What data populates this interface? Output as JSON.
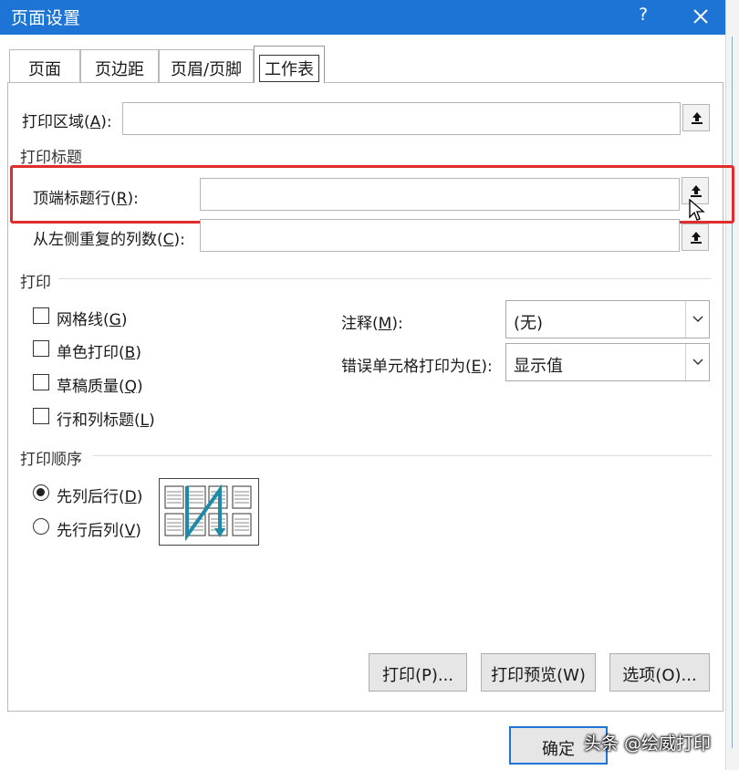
{
  "window": {
    "title": "页面设置",
    "help": "?"
  },
  "tabs": [
    "页面",
    "页边距",
    "页眉/页脚",
    "工作表"
  ],
  "print_area": {
    "label": "打印区域(",
    "hotkey": "A",
    "suffix": "):",
    "value": ""
  },
  "print_titles": {
    "section": "打印标题",
    "top_rows": {
      "label": "顶端标题行(",
      "hotkey": "R",
      "suffix": "):",
      "value": ""
    },
    "left_cols": {
      "label": "从左侧重复的列数(",
      "hotkey": "C",
      "suffix": "):",
      "value": ""
    }
  },
  "print": {
    "section": "打印",
    "checkboxes": [
      {
        "label": "网格线(",
        "hotkey": "G",
        "suffix": ")",
        "checked": false
      },
      {
        "label": "单色打印(",
        "hotkey": "B",
        "suffix": ")",
        "checked": false
      },
      {
        "label": "草稿质量(",
        "hotkey": "Q",
        "suffix": ")",
        "checked": false
      },
      {
        "label": "行和列标题(",
        "hotkey": "L",
        "suffix": ")",
        "checked": false
      }
    ],
    "comments": {
      "label": "注释(",
      "hotkey": "M",
      "suffix": "):",
      "value": "(无)"
    },
    "errors": {
      "label": "错误单元格打印为(",
      "hotkey": "E",
      "suffix": "):",
      "value": "显示值"
    }
  },
  "page_order": {
    "section": "打印顺序",
    "options": [
      {
        "label": "先列后行(",
        "hotkey": "D",
        "suffix": ")",
        "selected": true
      },
      {
        "label": "先行后列(",
        "hotkey": "V",
        "suffix": ")",
        "selected": false
      }
    ]
  },
  "buttons": {
    "print": "打印(P)...",
    "preview": "打印预览(W)",
    "options": "选项(O)...",
    "ok": "确定"
  },
  "watermark": "头条 @绘威打印",
  "colors": {
    "titlebar": "#1e74d4",
    "highlight": "#e02c2c",
    "arrow": "#1f8aa8"
  }
}
